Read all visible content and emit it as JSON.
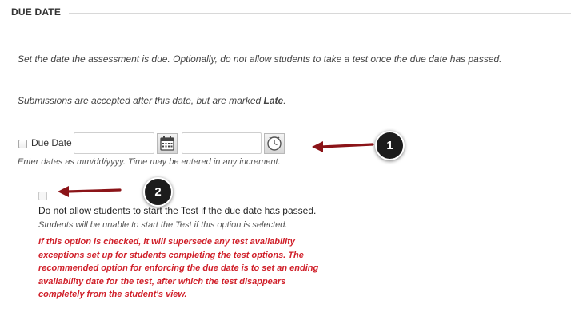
{
  "section": {
    "title": "DUE DATE"
  },
  "instructions": {
    "line1": "Set the date the assessment is due. Optionally, do not allow students to take a test once the due date has passed.",
    "line2_prefix": "Submissions are accepted after this date, but are marked ",
    "line2_emphasis": "Late",
    "line2_suffix": "."
  },
  "due_date": {
    "checkbox_label": "Due Date",
    "date_value": "",
    "time_value": "",
    "hint": "Enter dates as mm/dd/yyyy. Time may be entered in any increment.",
    "checked": false
  },
  "prevent_late": {
    "checked": false,
    "label": "Do not allow students to start the Test if the due date has passed.",
    "hint": "Students will be unable to start the Test if this option is selected.",
    "warning_lines": [
      "If this option is checked, it will supersede any test availability",
      "exceptions set up for students completing the test options. The",
      "recommended option for enforcing the due date is to set an ending",
      "availability date for the test, after which the test disappears",
      "completely from the student's view."
    ]
  },
  "annotations": [
    {
      "number": "1"
    },
    {
      "number": "2"
    }
  ],
  "colors": {
    "warning": "#d0202a",
    "arrow": "#8b1418",
    "callout": "#1c1c1c"
  },
  "icons": {
    "date_picker": "calendar-icon",
    "time_picker": "clock-icon"
  }
}
